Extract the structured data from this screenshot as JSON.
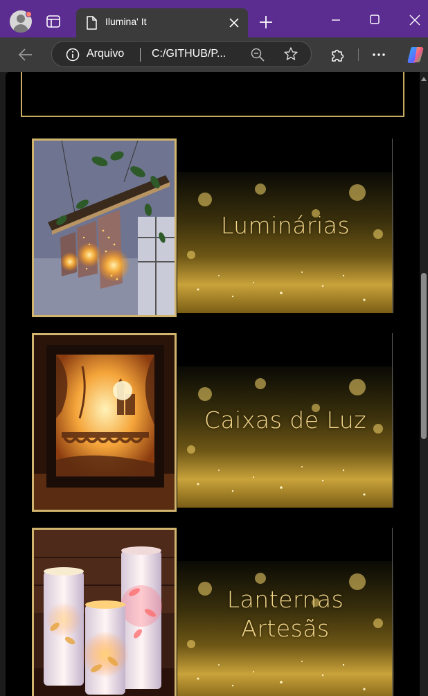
{
  "browser": {
    "tab_title": "Ilumina' It",
    "site_label": "Arquivo",
    "url": "C:/GITHUB/P...",
    "accent_color": "#5c2d91"
  },
  "icons": {
    "profile": "profile-avatar-icon",
    "tabs": "tab-actions-icon",
    "page": "page-document-icon",
    "close_tab": "close-icon",
    "new_tab": "plus-icon",
    "minimize": "minimize-icon",
    "maximize": "maximize-icon",
    "close_window": "close-window-icon",
    "back": "back-arrow-icon",
    "info": "info-icon",
    "zoom": "zoom-out-icon",
    "favorite": "star-icon",
    "extensions": "puzzle-icon",
    "more": "more-dots-icon",
    "copilot": "copilot-icon"
  },
  "page": {
    "accent_gold": "#d1b56e",
    "text_gold": "#f4d68a",
    "categories": [
      {
        "title": "Luminárias",
        "photo": "hanging grater lamps"
      },
      {
        "title": "Caixas de Luz",
        "photo": "paper shadow box lightbox"
      },
      {
        "title": "Lanternas Artesãs",
        "photo": "paper cut candle lanterns"
      }
    ]
  }
}
